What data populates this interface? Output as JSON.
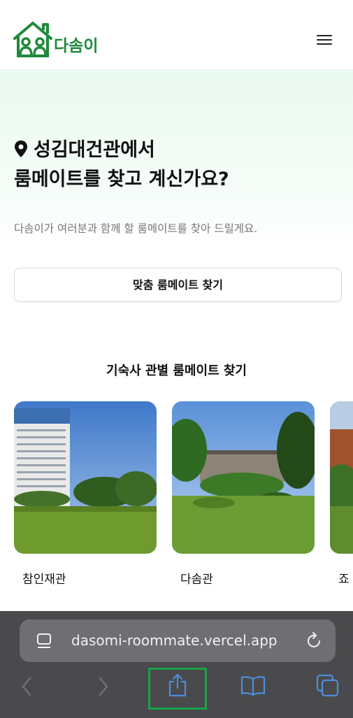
{
  "header": {
    "brand": "다솜이"
  },
  "hero": {
    "title_line1": "성김대건관에서",
    "title_line2": "룸메이트를 찾고 계신가요?",
    "subtitle": "다솜이가 여러분과 함께 할 룸메이트를 찾아 드릴게요.",
    "cta_label": "맞춤 룸메이트 찾기"
  },
  "dorms": {
    "section_title": "기숙사 관별 룸메이트 찾기",
    "items": [
      {
        "name": "참인재관"
      },
      {
        "name": "다솜관"
      },
      {
        "name": "죠"
      }
    ]
  },
  "browser": {
    "url": "dasomi-roommate.vercel.app"
  },
  "colors": {
    "brand": "#1f8a3c",
    "highlight": "#17a34a",
    "chrome": "#4a4a4c",
    "url_bar": "#6e6e73"
  }
}
